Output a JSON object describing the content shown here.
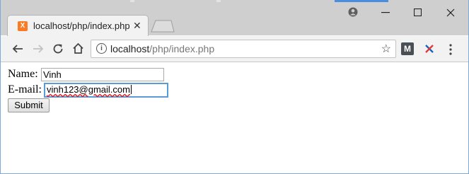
{
  "browser": {
    "tab": {
      "title": "localhost/php/index.php",
      "favicon_letter": "X"
    },
    "address_bar": {
      "host": "localhost",
      "path": "/php/index.php"
    },
    "extensions": [
      {
        "name": "m-extension",
        "letter": "M"
      },
      {
        "name": "x-extension"
      }
    ],
    "accent_color": "#fb7a24",
    "focus_color": "#5b9bd5"
  },
  "form": {
    "name_label": "Name:",
    "name_value": "Vinh",
    "email_label": "E-mail:",
    "email_value": "vinh123@gmail.com",
    "submit_label": "Submit"
  }
}
